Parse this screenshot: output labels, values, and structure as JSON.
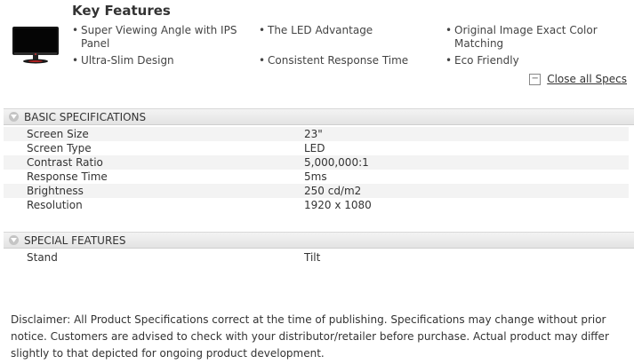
{
  "key_features": {
    "title": "Key Features",
    "items": [
      "Super Viewing Angle with IPS Panel",
      "The LED Advantage",
      "Original Image Exact Color Matching",
      "Ultra-Slim Design",
      "Consistent Response Time",
      "Eco Friendly"
    ]
  },
  "close_all_specs": {
    "icon": "minus-box-icon",
    "label": "Close all Specs"
  },
  "basic_specs": {
    "title": "BASIC SPECIFICATIONS",
    "rows": [
      {
        "label": "Screen Size",
        "value": "23\""
      },
      {
        "label": "Screen Type",
        "value": "LED"
      },
      {
        "label": "Contrast Ratio",
        "value": "5,000,000:1"
      },
      {
        "label": "Response Time",
        "value": "5ms"
      },
      {
        "label": "Brightness",
        "value": "250 cd/m2"
      },
      {
        "label": "Resolution",
        "value": "1920 x 1080"
      }
    ]
  },
  "special_features": {
    "title": "SPECIAL FEATURES",
    "rows": [
      {
        "label": "Stand",
        "value": "Tilt"
      }
    ]
  },
  "disclaimer": "Disclaimer: All Product Specifications correct at the time of publishing. Specifications may change without prior notice. Customers are advised to check with your distributor/retailer before purchase. Actual product may differ slightly to that depicted for ongoing product development.",
  "colors": {
    "section_bar": "#e8e8e8",
    "alt_row": "#f3f3f3",
    "text": "#333333"
  }
}
